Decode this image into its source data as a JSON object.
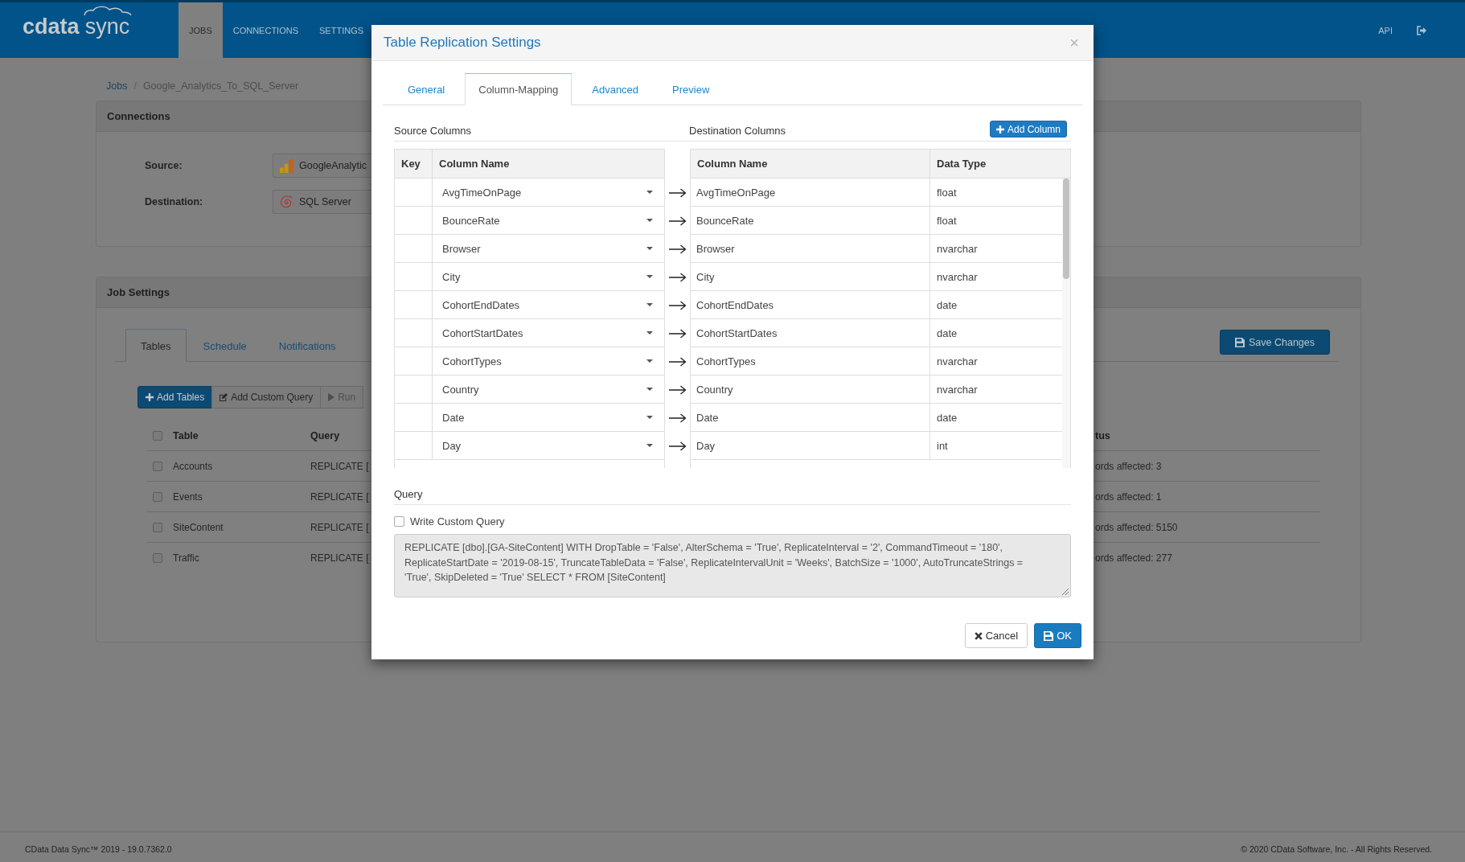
{
  "navbar": {
    "logo": {
      "brand": "cdata",
      "product": "sync"
    },
    "items": [
      {
        "label": "JOBS",
        "selected": true
      },
      {
        "label": "CONNECTIONS",
        "selected": false
      },
      {
        "label": "SETTINGS",
        "selected": false
      }
    ],
    "api_link": "API"
  },
  "breadcrumb": {
    "separator": "/",
    "items": [
      {
        "label": "Jobs",
        "kind": "link"
      },
      {
        "label": "Google_Analytics_To_SQL_Server",
        "kind": "current"
      }
    ]
  },
  "connections": {
    "title": "Connections",
    "fields": [
      {
        "label": "Source:",
        "value": "GoogleAnalytic"
      },
      {
        "label": "Destination:",
        "value": "SQL Server"
      }
    ]
  },
  "job_settings": {
    "title": "Job Settings",
    "tabs": [
      {
        "label": "Tables",
        "selected": true
      },
      {
        "label": "Schedule",
        "selected": false
      },
      {
        "label": "Notifications",
        "selected": false
      }
    ],
    "save_button": "Save Changes",
    "toolbar": [
      {
        "label": "Add Tables",
        "kind": "primary",
        "disabled": false
      },
      {
        "label": "Add Custom Query",
        "kind": "default",
        "disabled": false
      },
      {
        "label": "Run",
        "kind": "default",
        "disabled": true
      }
    ],
    "table": {
      "select_all_checked": false,
      "columns": [
        "Table",
        "Query",
        "tus"
      ],
      "rows": [
        {
          "checked": false,
          "table": "Accounts",
          "query": "REPLICATE [",
          "status": "ords affected: 3"
        },
        {
          "checked": false,
          "table": "Events",
          "query": "REPLICATE [",
          "status": "ords affected: 1"
        },
        {
          "checked": false,
          "table": "SiteContent",
          "query": "REPLICATE [",
          "status": "ords affected: 5150"
        },
        {
          "checked": false,
          "table": "Traffic",
          "query": "REPLICATE [",
          "status": "ords affected: 277"
        }
      ]
    }
  },
  "modal": {
    "title": "Table Replication Settings",
    "close_label": "×",
    "tabs": [
      {
        "label": "General",
        "selected": false
      },
      {
        "label": "Column-Mapping",
        "selected": true
      },
      {
        "label": "Advanced",
        "selected": false
      },
      {
        "label": "Preview",
        "selected": false
      }
    ],
    "source_title": "Source Columns",
    "destination_title": "Destination Columns",
    "add_column_button": "Add Column",
    "source_columns": [
      "Key",
      "Column Name"
    ],
    "destination_columns": [
      "Column Name",
      "Data Type"
    ],
    "mappings": [
      {
        "source": "AvgTimeOnPage",
        "destination": "AvgTimeOnPage",
        "data_type": "float"
      },
      {
        "source": "BounceRate",
        "destination": "BounceRate",
        "data_type": "float"
      },
      {
        "source": "Browser",
        "destination": "Browser",
        "data_type": "nvarchar"
      },
      {
        "source": "City",
        "destination": "City",
        "data_type": "nvarchar"
      },
      {
        "source": "CohortEndDates",
        "destination": "CohortEndDates",
        "data_type": "date"
      },
      {
        "source": "CohortStartDates",
        "destination": "CohortStartDates",
        "data_type": "date"
      },
      {
        "source": "CohortTypes",
        "destination": "CohortTypes",
        "data_type": "nvarchar"
      },
      {
        "source": "Country",
        "destination": "Country",
        "data_type": "nvarchar"
      },
      {
        "source": "Date",
        "destination": "Date",
        "data_type": "date"
      },
      {
        "source": "Day",
        "destination": "Day",
        "data_type": "int"
      }
    ],
    "query": {
      "title": "Query",
      "custom_checkbox": {
        "label": "Write Custom Query",
        "checked": false
      },
      "disabled": true,
      "text": "REPLICATE [dbo].[GA-SiteContent] WITH DropTable = 'False', AlterSchema = 'True', ReplicateInterval = '2', CommandTimeout = '180', ReplicateStartDate = '2019-08-15', TruncateTableData = 'False', ReplicateIntervalUnit = 'Weeks', BatchSize = '1000', AutoTruncateStrings = 'True', SkipDeleted = 'True' SELECT * FROM [SiteContent]"
    },
    "buttons": [
      {
        "label": "Cancel",
        "kind": "default"
      },
      {
        "label": "OK",
        "kind": "primary"
      }
    ]
  },
  "footer": {
    "version": "CData Data Sync™ 2019 - 19.0.7362.0",
    "copyright": "© 2020 CData Software, Inc. - All Rights Reserved."
  }
}
